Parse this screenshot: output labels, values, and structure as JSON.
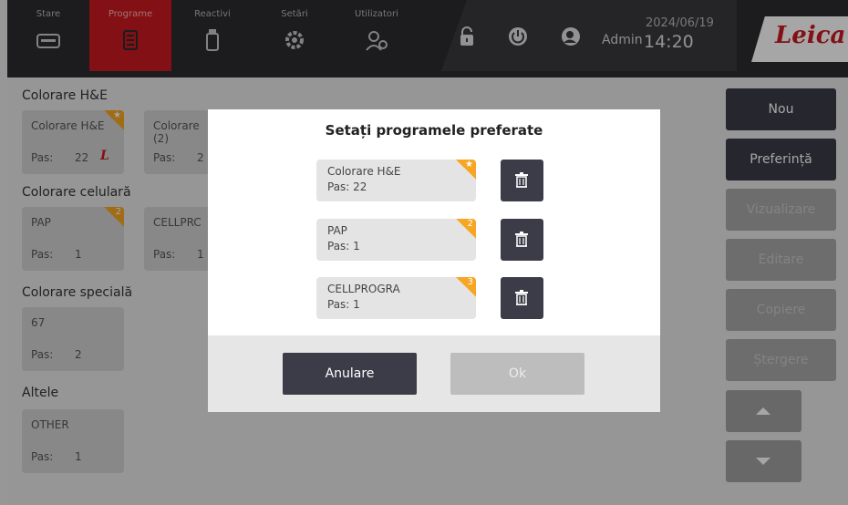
{
  "nav": {
    "tabs": [
      {
        "label": "Stare",
        "icon": "printer-icon"
      },
      {
        "label": "Programe",
        "icon": "program-list-icon",
        "active": true
      },
      {
        "label": "Reactivi",
        "icon": "reagent-bottle-icon"
      },
      {
        "label": "Setări",
        "icon": "gear-icon"
      },
      {
        "label": "Utilizatori",
        "icon": "users-icon"
      }
    ],
    "user": "Admin",
    "date": "2024/06/19",
    "time": "14:20",
    "brand": "Leica"
  },
  "groups": [
    {
      "title": "Colorare H&E"
    },
    {
      "title": "Colorare celulară"
    },
    {
      "title": "Colorare specială"
    },
    {
      "title": "Altele"
    }
  ],
  "cards": {
    "he1": {
      "name": "Colorare H&E",
      "pas_label": "Pas:",
      "pas": "22",
      "badge": "★"
    },
    "he2": {
      "name": "Colorare",
      "sub": "(2)",
      "pas_label": "Pas:",
      "pas": "2"
    },
    "pap": {
      "name": "PAP",
      "pas_label": "Pas:",
      "pas": "1",
      "badge": "2"
    },
    "cell": {
      "name": "CELLPRC",
      "pas_label": "Pas:",
      "pas": "1"
    },
    "sp67": {
      "name": "67",
      "pas_label": "Pas:",
      "pas": "2"
    },
    "other": {
      "name": "OTHER",
      "pas_label": "Pas:",
      "pas": "1"
    }
  },
  "side_buttons": {
    "new": "Nou",
    "pref": "Preferință",
    "view": "Vizualizare",
    "edit": "Editare",
    "copy": "Copiere",
    "delete": "Ștergere"
  },
  "dialog": {
    "title": "Setați programele preferate",
    "favorites": [
      {
        "name": "Colorare H&E",
        "pas": "Pas: 22",
        "badge": "★"
      },
      {
        "name": "PAP",
        "pas": "Pas: 1",
        "badge": "2"
      },
      {
        "name": "CELLPROGRA",
        "pas": "Pas: 1",
        "badge": "3"
      }
    ],
    "cancel_label": "Anulare",
    "ok_label": "Ok"
  },
  "colors": {
    "accent_red": "#c8191f",
    "badge_orange": "#f6a623",
    "dark_button": "#3b3c48"
  }
}
